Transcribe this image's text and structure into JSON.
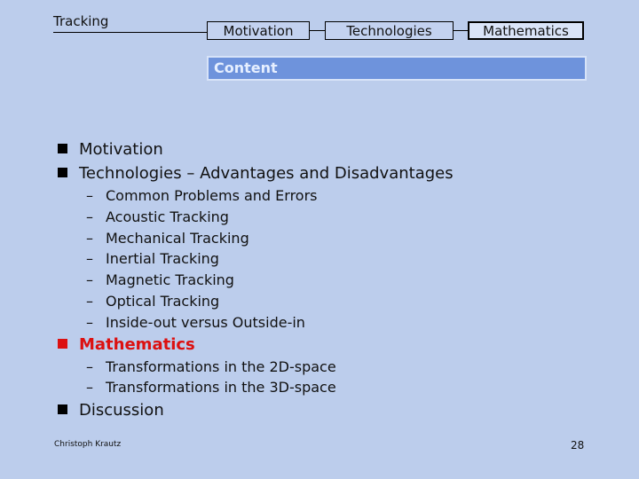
{
  "header": {
    "title": "Tracking",
    "nav": [
      {
        "label": "Motivation",
        "active": false
      },
      {
        "label": "Technologies",
        "active": false
      },
      {
        "label": "Mathematics",
        "active": true
      }
    ]
  },
  "section_bar": {
    "label": "Content",
    "color": "#6e93dc"
  },
  "outline": [
    {
      "label": "Motivation",
      "highlight": false,
      "children": []
    },
    {
      "label": "Technologies – Advantages and Disadvantages",
      "highlight": false,
      "children": [
        "Common Problems and Errors",
        "Acoustic Tracking",
        "Mechanical Tracking",
        "Inertial Tracking",
        "Magnetic Tracking",
        "Optical Tracking",
        "Inside-out versus Outside-in"
      ]
    },
    {
      "label": "Mathematics",
      "highlight": true,
      "highlight_color": "#dc1010",
      "children": [
        "Transformations in the 2D-space",
        "Transformations in the 3D-space"
      ]
    },
    {
      "label": "Discussion",
      "highlight": false,
      "children": []
    }
  ],
  "dash": "–",
  "footer": {
    "author": "Christoph Krautz",
    "page": "28"
  }
}
